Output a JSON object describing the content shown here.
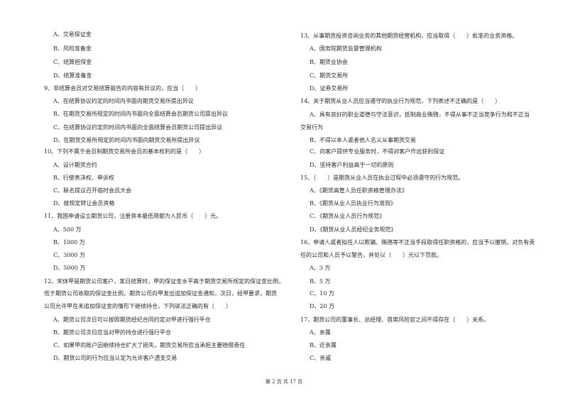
{
  "left_column": {
    "q8_options": [
      "A、交易保证金",
      "B、风险准备金",
      "C、结算担保金",
      "D、结算准备金"
    ],
    "q9": {
      "stem": "9、非结算会员对交易结算报告的内容有异议的，应当（　　）",
      "options": [
        "A、在结算协议约定的时间内书面向期货交易所提出异议",
        "B、在期货交易所规定的时间内书面向全面结算会员期货公司提出异议",
        "C、在结算协议约定的时间内书面向全面结算会员期货公司提出异议",
        "D、在期货交易所规定的时间内书面向期货交易所提出异议"
      ]
    },
    "q10": {
      "stem": "10、下列不属于会员制期货交易所会员的基本权利的是（　　）",
      "options": [
        "A、设计期货合约",
        "B、行使表决权、申诉权",
        "C、联名提议召开临时会员大会",
        "D、按规定转让会员资格"
      ]
    },
    "q11": {
      "stem": "11、我国申请设立期货公司，注册资本最低限额为人民币（　　）元。",
      "options": [
        "A、500 万",
        "B、1000 万",
        "C、3000 万",
        "D、5000 万"
      ]
    },
    "q12": {
      "stem_lines": [
        "12、宋体甲是期货公司客户，某日结算时，甲的保证金水平高于期货交易所规定的保证金比例，",
        "低于期货公司收取的保证金比例，期货公司向甲发出追加保证金通知，次日，经甲要求，期货",
        "公司允许甲在未追加保证金的情形下继续持仓，下列说法正确的有（　　）"
      ],
      "options": [
        "A、期货公司次日可以按照期货经纪合同约定对甲进行强行平仓",
        "B、期货公司次日应当对甲的持仓进行强行平仓",
        "C、如果甲的账户因继续持仓扩大了损失，期货交易所应当承担主要赔偿责任",
        "D、期货公司的行为应当认定为允许客户透支交易"
      ]
    }
  },
  "right_column": {
    "q13": {
      "stem": "13、从事期货投资咨询业务的其他期货经营机构，应当取得（　　）批准的业务资格。",
      "options": [
        "A、国务院期货监督管理机构",
        "B、期货业协会",
        "C、期货交易所",
        "D、证券交易所"
      ]
    },
    "q14": {
      "stem": "14、关于期货从业人员应当遵守的执业行为规范，下列表述不正确的是（　　）",
      "option_a_lines": [
        "A、具有良好的职业道德与守法意识，抵制商业贿赂，不得从事不正当竞争行为和不正当",
        "交易行为"
      ],
      "options": [
        "B、不得以本人或者他人名义从事期货交易",
        "C、向客户提供专业服务时，不得对客户作出获利保证",
        "D、坚持客户利益高于一切的原则"
      ]
    },
    "q15": {
      "stem": "15、（　　）是期货从业人员在执业过程中必须遵守的行为规范。",
      "options": [
        "A、《期货高管人员任职资格管理办法》",
        "B、《期货从业人员执业行为准则》",
        "C、《期货从业人员行为规范》",
        "D、《期货从业人员经纪业务规范》"
      ]
    },
    "q16": {
      "stem_lines": [
        "16、申请人或者拟任人以欺骗、贿赂等不正当手段取得任职资格的，应当予以撤销，对负有责",
        "任的公司和人员予以警告，并处以（　　）元以下罚款。"
      ],
      "options": [
        "A、3 万",
        "B、5 万",
        "C、10 万",
        "D、20 万"
      ]
    },
    "q17": {
      "stem": "17、期货公司的董事长、总经理、首席风险官之间不得存在（　　）关系。",
      "options": [
        "A、亲属",
        "B、近亲属",
        "C、亲戚"
      ]
    }
  },
  "footer": {
    "page_label": "第 2 页 共 17 页"
  }
}
